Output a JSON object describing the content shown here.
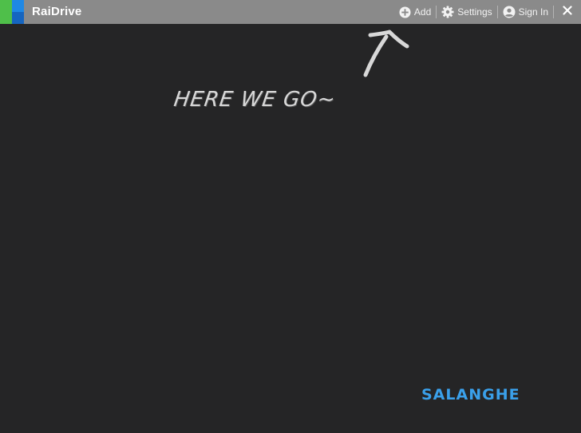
{
  "app": {
    "title": "RaiDrive"
  },
  "toolbar": {
    "add_label": "Add",
    "settings_label": "Settings",
    "signin_label": "Sign In",
    "close_label": "✕"
  },
  "overlay": {
    "hint_text": "HERE WE GO~",
    "watermark": "SALANGHE"
  },
  "colors": {
    "titlebar": "#8a8a8a",
    "background": "#252526",
    "logo_green": "#4fbf4a",
    "logo_blue": "#1e88e5",
    "watermark": "#3aa0ea"
  },
  "icons": [
    "raidrive-logo-icon",
    "add-circle-icon",
    "gear-icon",
    "user-circle-icon",
    "close-icon",
    "arrow-up-icon"
  ]
}
